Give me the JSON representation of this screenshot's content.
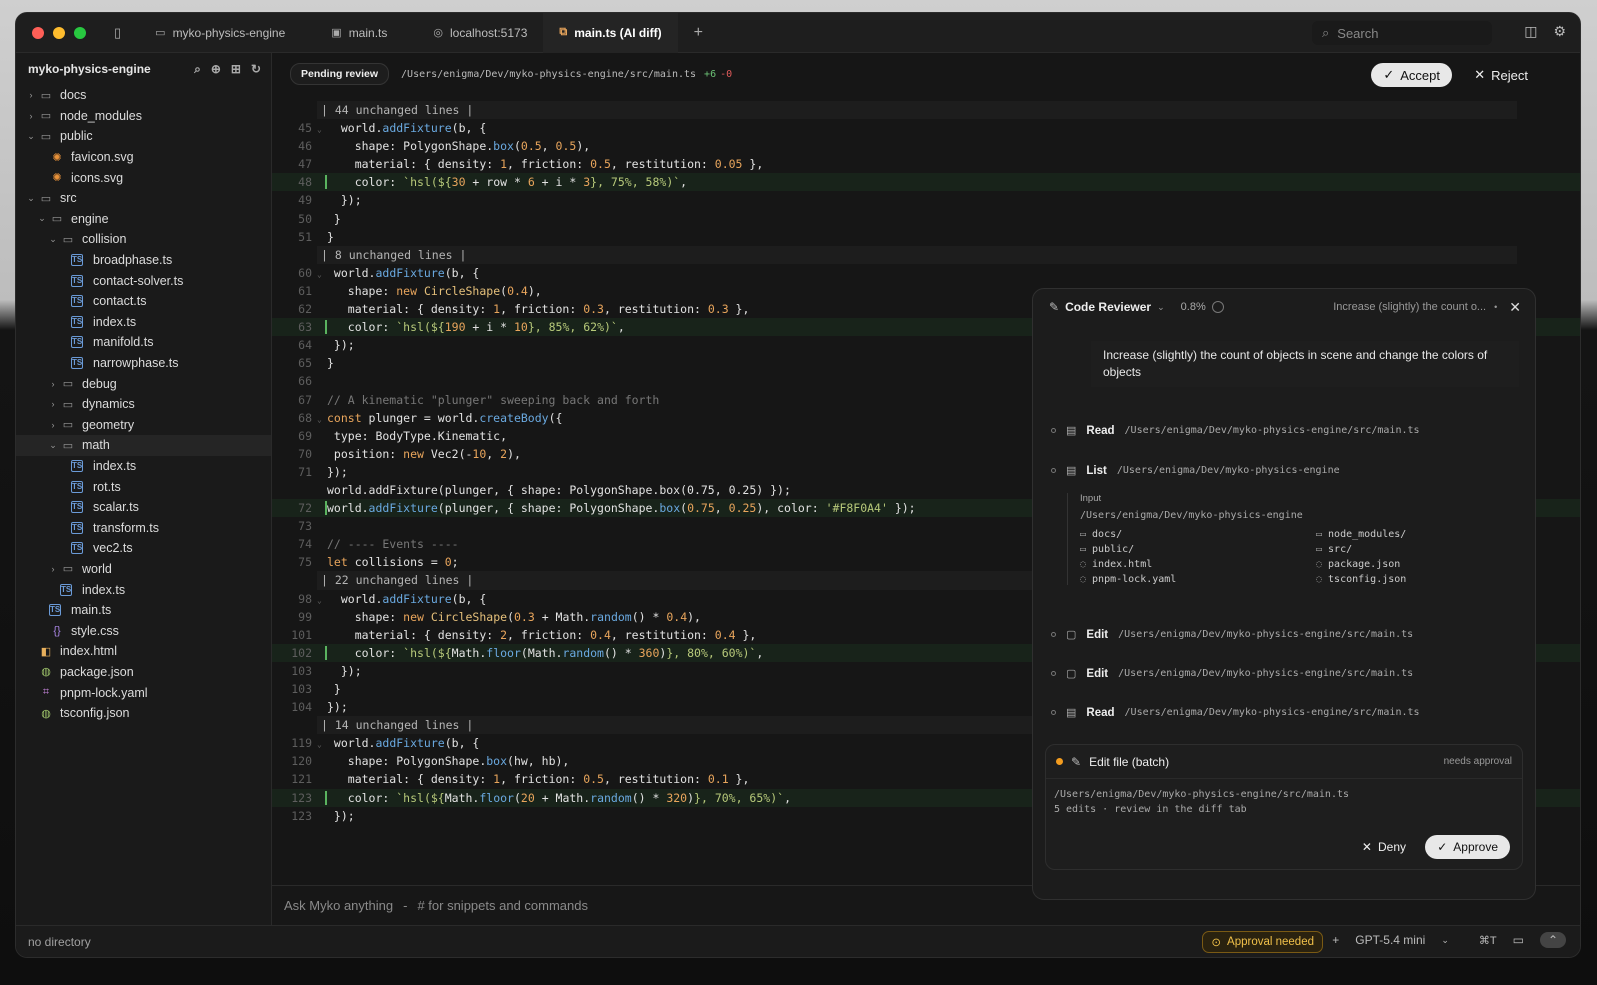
{
  "tabs": [
    {
      "label": "myko-physics-engine",
      "icon": "folder-icon"
    },
    {
      "label": "main.ts",
      "icon": "ts-file-icon"
    },
    {
      "label": "localhost:5173",
      "icon": "globe-icon"
    },
    {
      "label": "main.ts (AI diff)",
      "icon": "diff-icon"
    }
  ],
  "search_label": "Search",
  "sidebar": {
    "title": "myko-physics-engine",
    "items": [
      {
        "label": "docs",
        "type": "folder",
        "depth": 0,
        "chevron": "›"
      },
      {
        "label": "node_modules",
        "type": "folder",
        "depth": 0,
        "chevron": "›"
      },
      {
        "label": "public",
        "type": "folder",
        "depth": 0,
        "chevron": "⌄"
      },
      {
        "label": "favicon.svg",
        "type": "svg",
        "depth": 1,
        "chevron": ""
      },
      {
        "label": "icons.svg",
        "type": "svg",
        "depth": 1,
        "chevron": ""
      },
      {
        "label": "src",
        "type": "folder",
        "depth": 0,
        "chevron": "⌄"
      },
      {
        "label": "engine",
        "type": "folder",
        "depth": 1,
        "chevron": "⌄"
      },
      {
        "label": "collision",
        "type": "folder",
        "depth": 2,
        "chevron": "⌄"
      },
      {
        "label": "broadphase.ts",
        "type": "ts",
        "depth": 3,
        "chevron": ""
      },
      {
        "label": "contact-solver.ts",
        "type": "ts",
        "depth": 3,
        "chevron": ""
      },
      {
        "label": "contact.ts",
        "type": "ts",
        "depth": 3,
        "chevron": ""
      },
      {
        "label": "index.ts",
        "type": "ts",
        "depth": 3,
        "chevron": ""
      },
      {
        "label": "manifold.ts",
        "type": "ts",
        "depth": 3,
        "chevron": ""
      },
      {
        "label": "narrowphase.ts",
        "type": "ts",
        "depth": 3,
        "chevron": ""
      },
      {
        "label": "debug",
        "type": "folder",
        "depth": 2,
        "chevron": "›"
      },
      {
        "label": "dynamics",
        "type": "folder",
        "depth": 2,
        "chevron": "›"
      },
      {
        "label": "geometry",
        "type": "folder",
        "depth": 2,
        "chevron": "›"
      },
      {
        "label": "math",
        "type": "folder",
        "depth": 2,
        "chevron": "⌄",
        "selected": true
      },
      {
        "label": "index.ts",
        "type": "ts",
        "depth": 3,
        "chevron": ""
      },
      {
        "label": "rot.ts",
        "type": "ts",
        "depth": 3,
        "chevron": ""
      },
      {
        "label": "scalar.ts",
        "type": "ts",
        "depth": 3,
        "chevron": ""
      },
      {
        "label": "transform.ts",
        "type": "ts",
        "depth": 3,
        "chevron": ""
      },
      {
        "label": "vec2.ts",
        "type": "ts",
        "depth": 3,
        "chevron": ""
      },
      {
        "label": "world",
        "type": "folder",
        "depth": 2,
        "chevron": "›"
      },
      {
        "label": "index.ts",
        "type": "ts",
        "depth": 2,
        "chevron": ""
      },
      {
        "label": "main.ts",
        "type": "ts",
        "depth": 1,
        "chevron": ""
      },
      {
        "label": "style.css",
        "type": "css",
        "depth": 1,
        "chevron": ""
      },
      {
        "label": "index.html",
        "type": "html",
        "depth": 0,
        "chevron": ""
      },
      {
        "label": "package.json",
        "type": "json",
        "depth": 0,
        "chevron": ""
      },
      {
        "label": "pnpm-lock.yaml",
        "type": "yaml",
        "depth": 0,
        "chevron": ""
      },
      {
        "label": "tsconfig.json",
        "type": "json",
        "depth": 0,
        "chevron": ""
      }
    ]
  },
  "diff": {
    "badge": "Pending review",
    "path": "/Users/enigma/Dev/myko-physics-engine/src/main.ts",
    "added": "+6",
    "removed": "-0",
    "accept": "Accept",
    "reject": "Reject",
    "lines": [
      {
        "kind": "unch",
        "text": "| 44 unchanged lines |"
      },
      {
        "ln": "45",
        "fold": true,
        "html": "  world.<span class='fn'>addFixture</span>(b, {"
      },
      {
        "ln": "46",
        "html": "    shape: PolygonShape.<span class='fn'>box</span>(<span class='num'>0.5</span>, <span class='num'>0.5</span>),"
      },
      {
        "ln": "47",
        "html": "    material: { density: <span class='num'>1</span>, friction: <span class='num'>0.5</span>, restitution: <span class='num'>0.05</span> },"
      },
      {
        "ln": "48",
        "add": true,
        "html": "    color: <span class='str'>`hsl(${</span><span class='num'>30</span> + row * <span class='num'>6</span> + i * <span class='num'>3</span><span class='str'>}, 75%, 58%)`</span>,"
      },
      {
        "ln": "49",
        "html": "  });"
      },
      {
        "ln": "50",
        "html": " }"
      },
      {
        "ln": "51",
        "html": "}"
      },
      {
        "kind": "unch",
        "text": "| 8 unchanged lines |"
      },
      {
        "ln": "60",
        "fold": true,
        "html": " world.<span class='fn'>addFixture</span>(b, {"
      },
      {
        "ln": "61",
        "html": "   shape: <span class='kw'>new</span> <span class='cls'>CircleShape</span>(<span class='num'>0.4</span>),"
      },
      {
        "ln": "62",
        "html": "   material: { density: <span class='num'>1</span>, friction: <span class='num'>0.3</span>, restitution: <span class='num'>0.3</span> },"
      },
      {
        "ln": "63",
        "add": true,
        "html": "   color: <span class='str'>`hsl(${</span><span class='num'>190</span> + i * <span class='num'>10</span><span class='str'>}, 85%, 62%)`</span>,"
      },
      {
        "ln": "64",
        "html": " });"
      },
      {
        "ln": "65",
        "html": "}"
      },
      {
        "ln": "66",
        "html": ""
      },
      {
        "ln": "67",
        "html": "<span class='cmt'>// A kinematic \"plunger\" sweeping back and forth</span>"
      },
      {
        "ln": "68",
        "fold": true,
        "html": "<span class='kw'>const</span> plunger = world.<span class='fn'>createBody</span>({"
      },
      {
        "ln": "69",
        "html": " type: BodyType.Kinematic,"
      },
      {
        "ln": "70",
        "html": " position: <span class='kw'>new</span> Vec2(-<span class='num'>10</span>, <span class='num'>2</span>),"
      },
      {
        "ln": "71",
        "html": "});"
      },
      {
        "ln": "",
        "html": "world.addFixture(plunger, { shape: PolygonShape.box(0.75, 0.25) });"
      },
      {
        "ln": "72",
        "add": true,
        "html": "world.<span class='fn'>addFixture</span>(plunger, { shape: PolygonShape.<span class='fn'>box</span>(<span class='num'>0.75</span>, <span class='num'>0.25</span>), color: <span class='str'>'#F8F0A4'</span> });"
      },
      {
        "ln": "73",
        "html": ""
      },
      {
        "ln": "74",
        "html": "<span class='cmt'>// ---- Events ----</span>"
      },
      {
        "ln": "75",
        "html": "<span class='kw'>let</span> collisions = <span class='num'>0</span>;"
      },
      {
        "kind": "unch",
        "text": "| 22 unchanged lines |"
      },
      {
        "ln": "98",
        "fold": true,
        "html": "  world.<span class='fn'>addFixture</span>(b, {"
      },
      {
        "ln": "99",
        "html": "    shape: <span class='kw'>new</span> <span class='cls'>CircleShape</span>(<span class='num'>0.3</span> + Math.<span class='fn'>random</span>() * <span class='num'>0.4</span>),"
      },
      {
        "ln": "101",
        "html": "    material: { density: <span class='num'>2</span>, friction: <span class='num'>0.4</span>, restitution: <span class='num'>0.4</span> },"
      },
      {
        "ln": "102",
        "add": true,
        "html": "    color: <span class='str'>`hsl(${</span>Math.<span class='fn'>floor</span>(Math.<span class='fn'>random</span>() * <span class='num'>360</span>)<span class='str'>}, 80%, 60%)`</span>,"
      },
      {
        "ln": "103",
        "html": "  });"
      },
      {
        "ln": "103",
        "html": " }"
      },
      {
        "ln": "104",
        "html": "});"
      },
      {
        "kind": "unch",
        "text": "| 14 unchanged lines |"
      },
      {
        "ln": "119",
        "fold": true,
        "html": " world.<span class='fn'>addFixture</span>(b, {"
      },
      {
        "ln": "120",
        "html": "   shape: PolygonShape.<span class='fn'>box</span>(hw, hb),"
      },
      {
        "ln": "121",
        "html": "   material: { density: <span class='num'>1</span>, friction: <span class='num'>0.5</span>, restitution: <span class='num'>0.1</span> },"
      },
      {
        "ln": "123",
        "add": true,
        "html": "   color: <span class='str'>`hsl(${</span>Math.<span class='fn'>floor</span>(<span class='num'>20</span> + Math.<span class='fn'>random</span>() * <span class='num'>320</span>)<span class='str'>}, 70%, 65%)`</span>,"
      },
      {
        "ln": "123",
        "html": " });"
      }
    ]
  },
  "composer": {
    "placeholder": "Ask Myko anything",
    "hint": "# for snippets and commands"
  },
  "status": {
    "left": "no directory",
    "approval": "Approval needed",
    "model": "GPT-5.4 mini",
    "kbd": "⌘T"
  },
  "panel": {
    "title": "Code Reviewer",
    "percent": "0.8%",
    "subtitle": "Increase (slightly) the count o...",
    "message": "Increase (slightly) the count of objects in scene and change the colors of objects",
    "actions": [
      {
        "label": "Read",
        "path": "/Users/enigma/Dev/myko-physics-engine/src/main.ts",
        "icon": "read-icon"
      },
      {
        "label": "List",
        "path": "/Users/enigma/Dev/myko-physics-engine",
        "icon": "list-icon"
      },
      {
        "label": "Edit",
        "path": "/Users/enigma/Dev/myko-physics-engine/src/main.ts",
        "icon": "edit-icon"
      },
      {
        "label": "Edit",
        "path": "/Users/enigma/Dev/myko-physics-engine/src/main.ts",
        "icon": "edit-icon"
      },
      {
        "label": "Read",
        "path": "/Users/enigma/Dev/myko-physics-engine/src/main.ts",
        "icon": "read-icon"
      }
    ],
    "list_input_label": "Input",
    "list_input": "/Users/enigma/Dev/myko-physics-engine",
    "list_items": [
      "docs/",
      "node_modules/",
      "public/",
      "src/",
      "index.html",
      "package.json",
      "pnpm-lock.yaml",
      "tsconfig.json"
    ],
    "card": {
      "title": "Edit file (batch)",
      "status": "needs approval",
      "path": "/Users/enigma/Dev/myko-physics-engine/src/main.ts",
      "desc": "5 edits · review in the diff tab",
      "deny": "Deny",
      "approve": "Approve"
    }
  },
  "colors": {
    "accent": "#f39c1f",
    "added": "#6cc276",
    "removed": "#e05b5b"
  }
}
